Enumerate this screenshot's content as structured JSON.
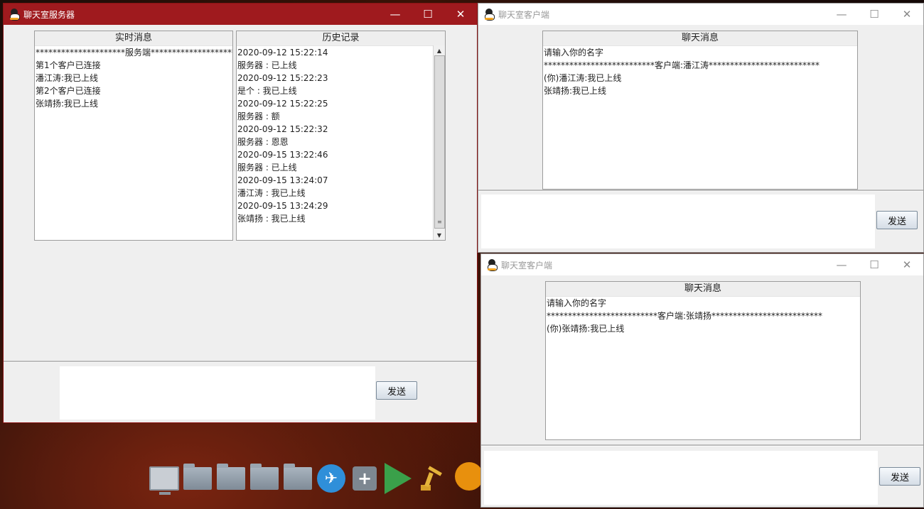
{
  "server": {
    "title": "聊天室服务器",
    "controls": {
      "minimize": "—",
      "maximize": "☐",
      "close": "✕"
    },
    "realtime": {
      "header": "实时消息",
      "lines": [
        "*********************服务端*********************",
        "第1个客户已连接",
        "潘江涛:我已上线",
        "第2个客户已连接",
        "张靖扬:我已上线"
      ]
    },
    "history": {
      "header": "历史记录",
      "lines": [
        "2020-09-12 15:22:14",
        "服务器 : 已上线",
        "2020-09-12 15:22:23",
        "是个 : 我已上线",
        "2020-09-12 15:22:25",
        "服务器 : 额",
        "2020-09-12 15:22:32",
        "服务器 : 恩恩",
        "2020-09-15 13:22:46",
        "服务器 : 已上线",
        "2020-09-15 13:24:07",
        "潘江涛 : 我已上线",
        "2020-09-15 13:24:29",
        "张靖扬 : 我已上线"
      ]
    },
    "input_value": "",
    "send_label": "发送"
  },
  "client1": {
    "title": "聊天室客户端",
    "controls": {
      "minimize": "—",
      "maximize": "☐",
      "close": "✕"
    },
    "messages": {
      "header": "聊天消息",
      "lines": [
        "请输入你的名字",
        "**************************客户端:潘江涛**************************",
        "(你)潘江涛:我已上线",
        "张靖扬:我已上线"
      ]
    },
    "input_value": "",
    "send_label": "发送"
  },
  "client2": {
    "title": "聊天室客户端",
    "controls": {
      "minimize": "—",
      "maximize": "☐",
      "close": "✕"
    },
    "messages": {
      "header": "聊天消息",
      "lines": [
        "请输入你的名字",
        "**************************客户端:张靖扬**************************",
        "(你)张靖扬:我已上线"
      ]
    },
    "input_value": "",
    "send_label": "发送"
  },
  "taskbar": {
    "icons": [
      "monitor-icon",
      "folder-file-icon",
      "folder-monitor-icon",
      "folder-icon",
      "folder-icon",
      "bird-app-icon",
      "plus-app-icon",
      "play-store-icon",
      "robot-arm-icon",
      "orange-app-icon"
    ]
  },
  "colors": {
    "server_titlebar": "#9f1a1e",
    "window_bg": "#efefef",
    "send_button_border": "#7a8a99"
  }
}
